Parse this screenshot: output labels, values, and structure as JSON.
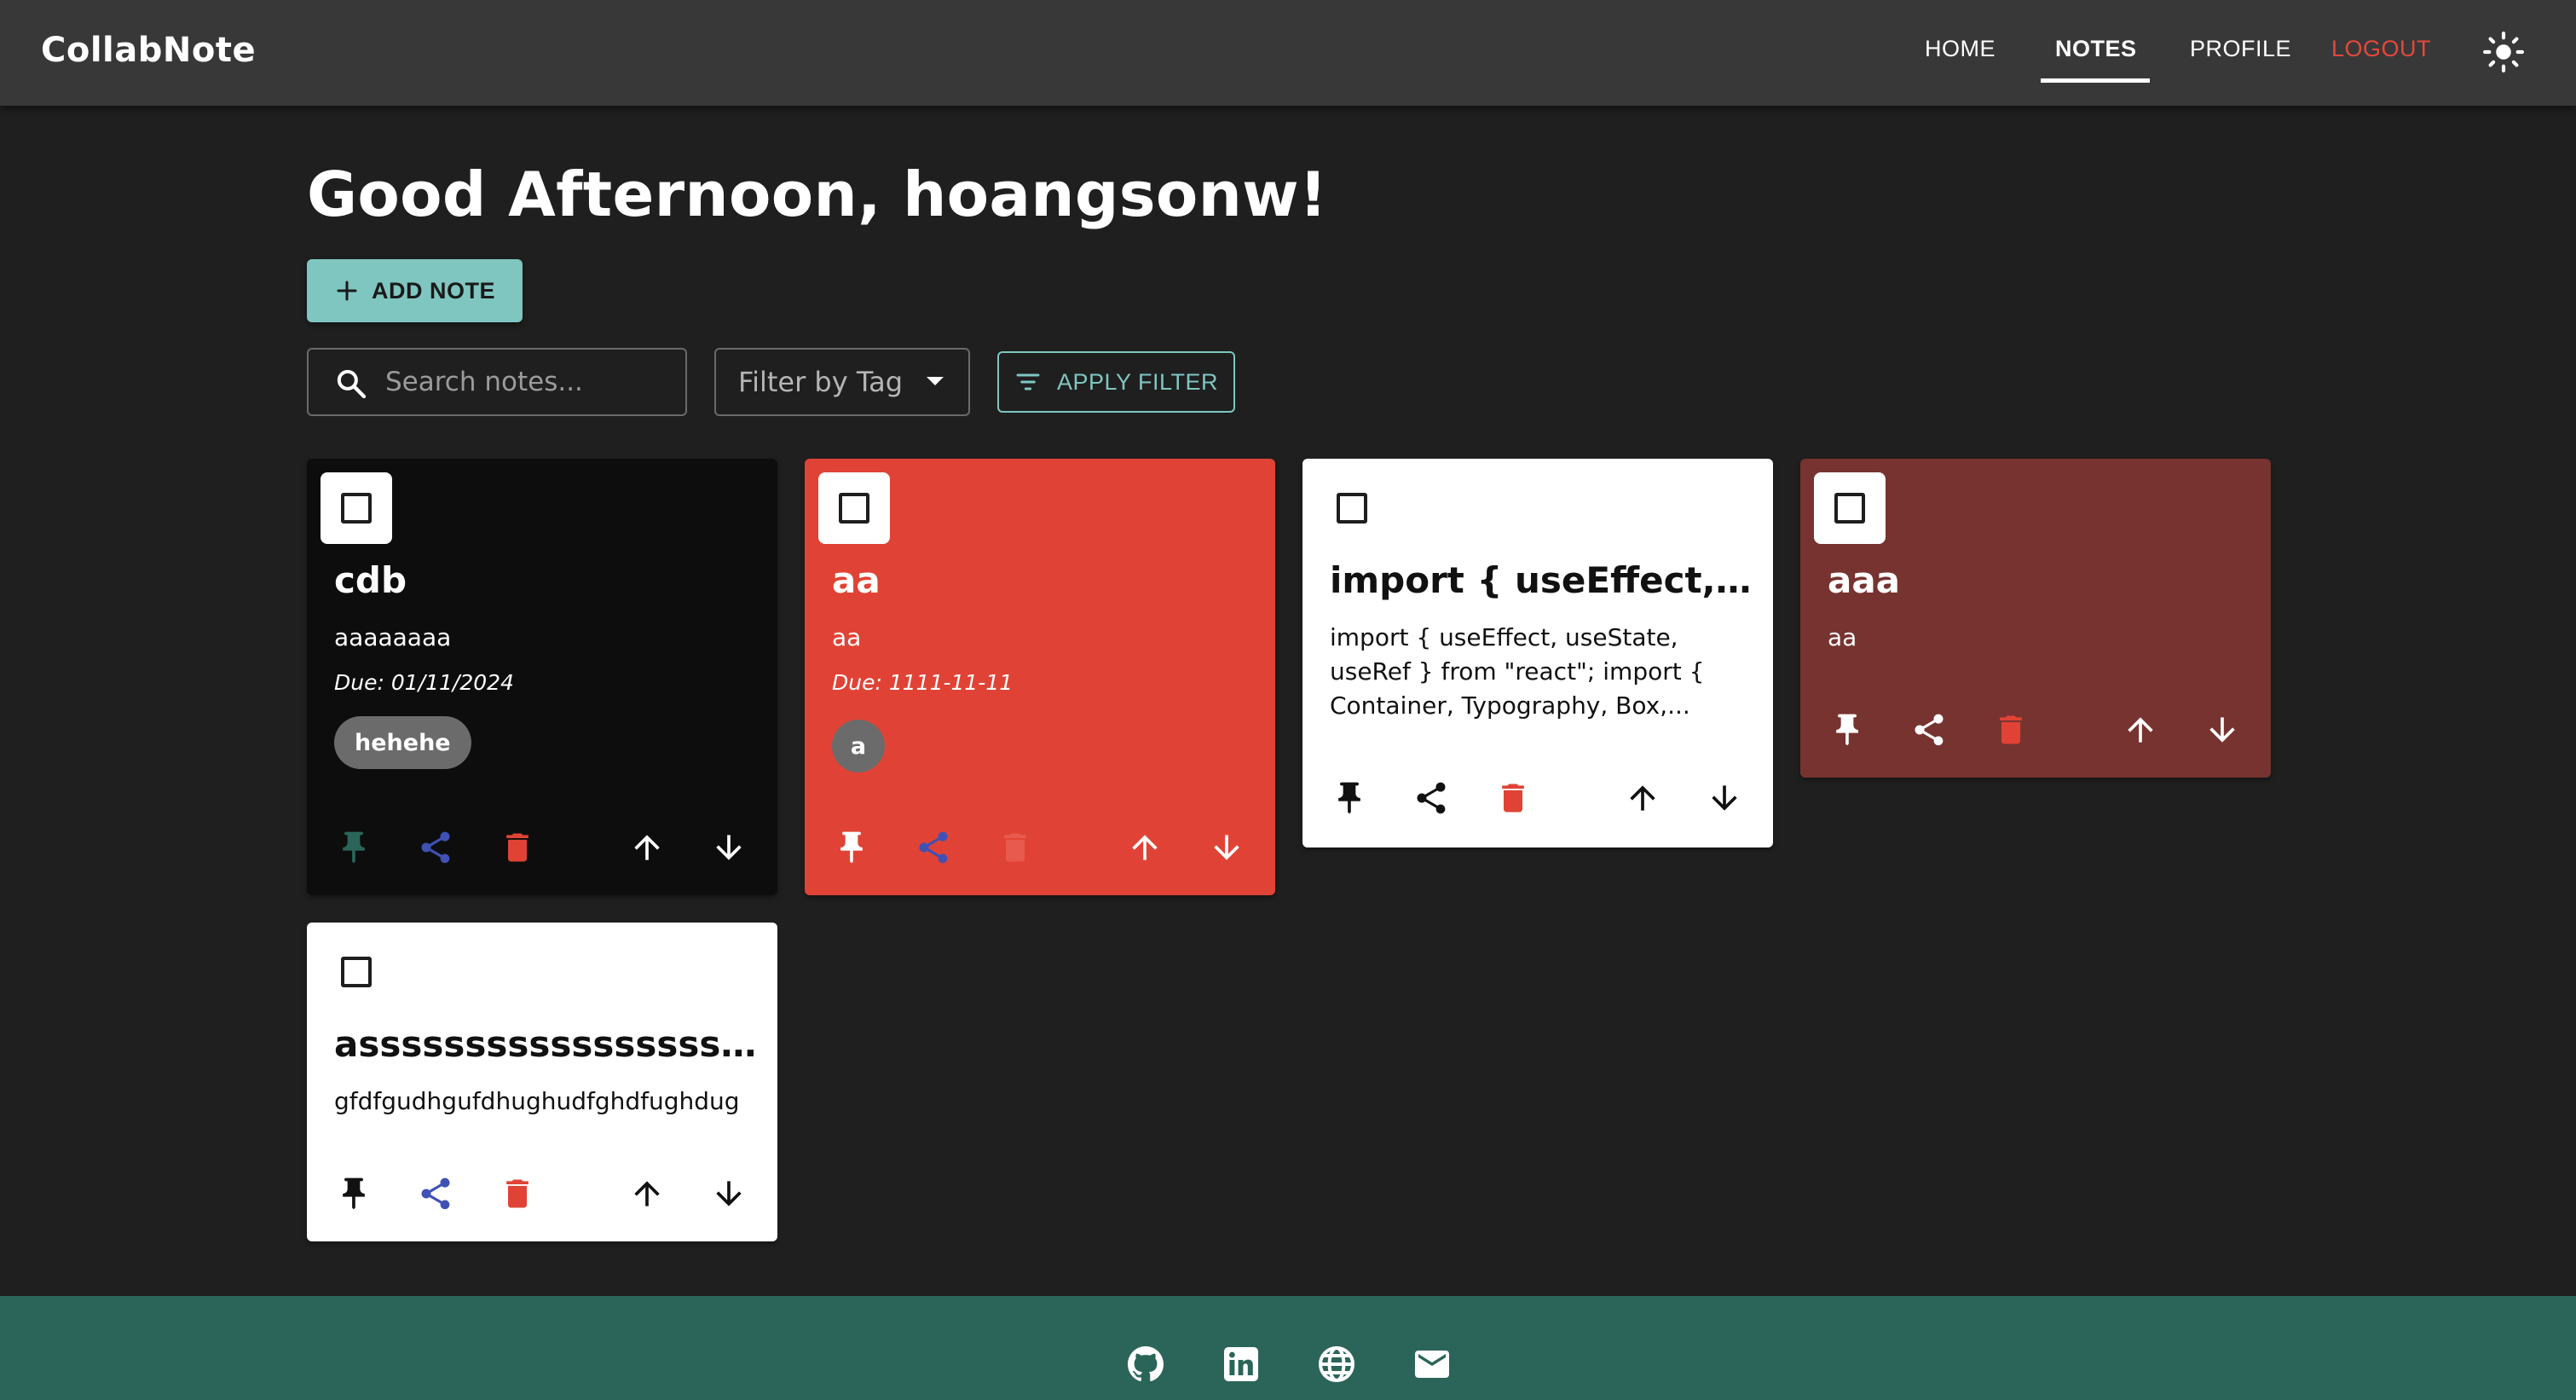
{
  "app": {
    "brand": "CollabNote"
  },
  "nav": {
    "home": "HOME",
    "notes": "NOTES",
    "profile": "PROFILE",
    "logout": "LOGOUT",
    "active": "NOTES"
  },
  "main": {
    "greeting": "Good Afternoon, hoangsonw!",
    "add_note_label": "ADD NOTE",
    "search_placeholder": "Search notes...",
    "search_value": "",
    "tag_filter_label": "Filter by Tag",
    "apply_filter_label": "APPLY FILTER"
  },
  "notes": [
    {
      "title": "cdb",
      "content": "aaaaaaaa",
      "due": "Due: 01/11/2024",
      "tag": "hehehe",
      "color": "#0d0d0d",
      "text_color": "#ffffff"
    },
    {
      "title": "aa",
      "content": "aa",
      "due": "Due: 1111-11-11",
      "avatar": "a",
      "color": "#e04335",
      "text_color": "#ffffff"
    },
    {
      "title": "import { useEffect, use...",
      "content": "import { useEffect, useState, useRef } from \"react\"; import { Container, Typography, Box,...",
      "color": "#ffffff",
      "text_color": "#111111"
    },
    {
      "title": "aaa",
      "content": "aa",
      "color": "#773330",
      "text_color": "#ffffff"
    },
    {
      "title": "asssssssssssssssssss...",
      "content": "gfdfgudhgufdhughudfghdfughdug",
      "color": "#ffffff",
      "text_color": "#111111"
    }
  ],
  "colors": {
    "primary": "#7fc6c0",
    "appbar": "#383838",
    "background": "#1f1f1f",
    "footer": "#2b6559",
    "logout": "#e5483b",
    "share": "#3f51b5",
    "delete": "#e04335",
    "pin_active": "#2b6559"
  },
  "footer": {
    "icons": [
      "github-icon",
      "linkedin-icon",
      "globe-icon",
      "email-icon"
    ]
  }
}
